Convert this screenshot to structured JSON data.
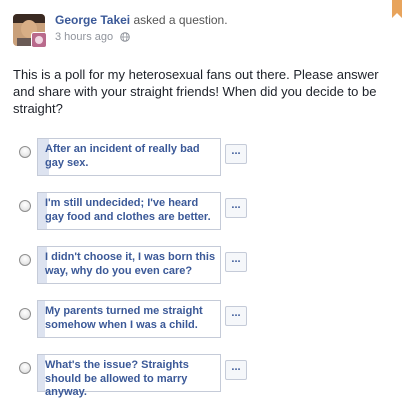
{
  "post": {
    "author_name": "George Takei",
    "action_text": "asked a question.",
    "timestamp": "3 hours ago",
    "privacy_icon": "globe-icon",
    "question": "This is a poll for my heterosexual fans out there. Please answer and share with your straight friends! When did you decide to be straight?",
    "options": [
      {
        "label": "After an incident of really bad gay sex.",
        "vote_fraction": 0.06,
        "more_label": "..."
      },
      {
        "label": "I'm still undecided; I've heard gay food and clothes are better.",
        "vote_fraction": 0.05,
        "more_label": "..."
      },
      {
        "label": "I didn't choose it, I was born this way, why do you even care?",
        "vote_fraction": 0.05,
        "more_label": "..."
      },
      {
        "label": "My parents turned me straight somehow when I was a child.",
        "vote_fraction": 0.04,
        "more_label": "..."
      },
      {
        "label": "What's the issue? Straights should be allowed to marry anyway.",
        "vote_fraction": 0.04,
        "more_label": "..."
      }
    ]
  },
  "colors": {
    "link_blue": "#3b5998",
    "option_border": "#c5cbd8",
    "vote_fill": "#dde3f0",
    "bookmark_orange": "#e8a45c"
  }
}
